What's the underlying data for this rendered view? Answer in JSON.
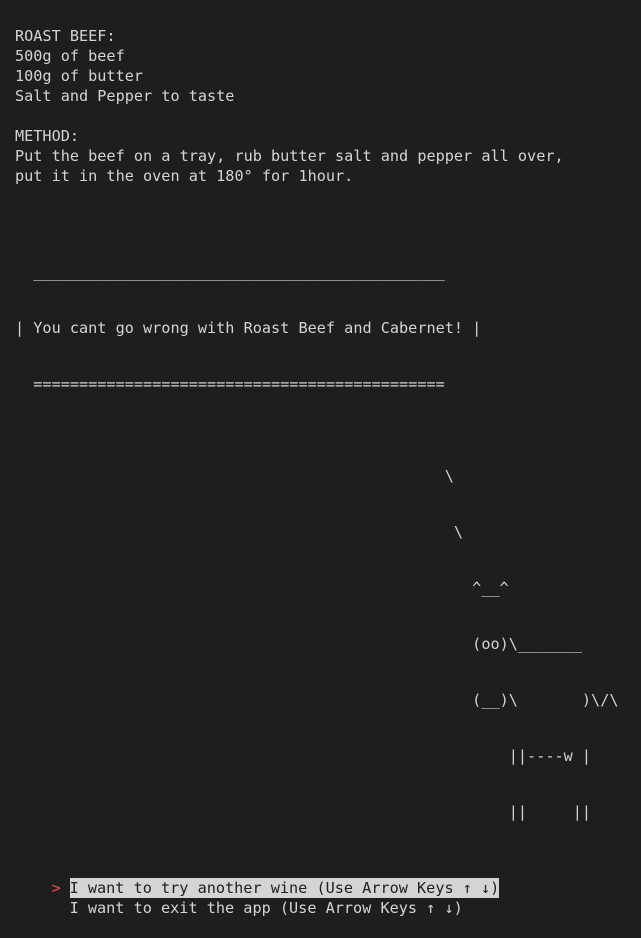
{
  "recipe": {
    "title": "ROAST BEEF:",
    "ingredients": [
      "500g of beef",
      "100g of butter",
      "Salt and Pepper to taste"
    ],
    "method_heading": "METHOD:",
    "method_lines": [
      "Put the beef on a tray, rub butter salt and pepper all over,",
      "put it in the oven at 180° for 1hour."
    ]
  },
  "cowsay": {
    "top_border": "  _____________________________________________",
    "message_line": "| You cant go wrong with Roast Beef and Cabernet! |",
    "bottom_border": "  =============================================",
    "art_lines": [
      "                                               \\",
      "                                                \\",
      "                                                  ^__^",
      "                                                  (oo)\\_______",
      "                                                  (__)\\       )\\/\\",
      "                                                      ||----w |",
      "                                                      ||     ||"
    ]
  },
  "menu": {
    "pointer_symbol": ">",
    "options": [
      {
        "label": "I want to try another wine (Use Arrow Keys ↑ ↓)"
      },
      {
        "label": "I want to exit the app (Use Arrow Keys ↑ ↓)"
      }
    ]
  }
}
